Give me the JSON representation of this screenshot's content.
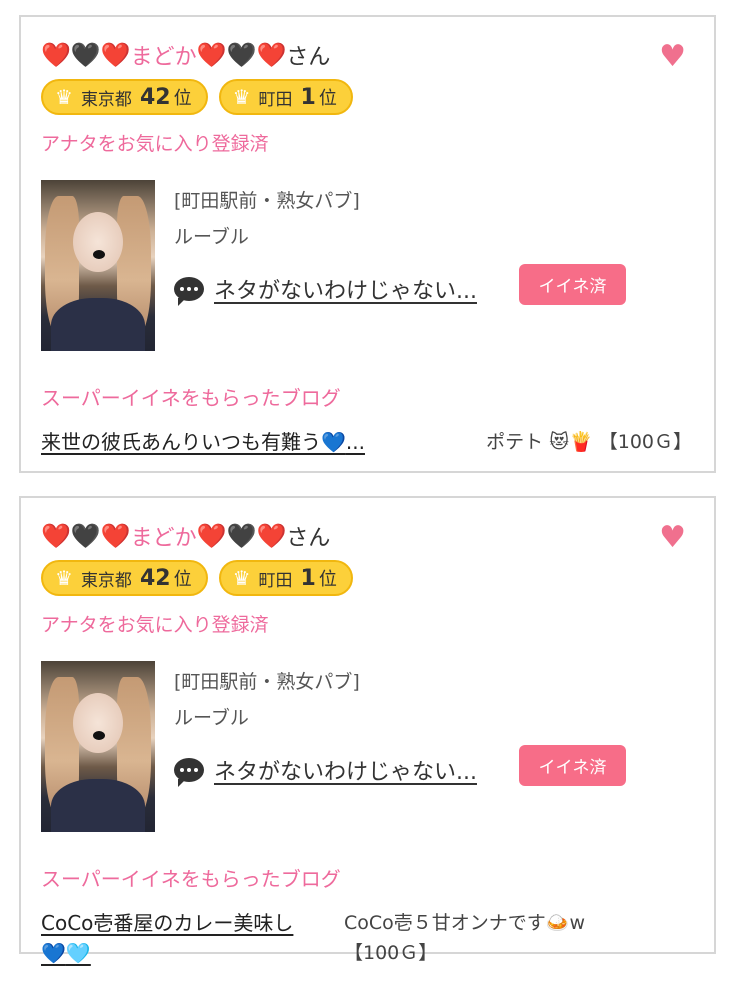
{
  "cards": [
    {
      "name": {
        "h1": "❤️",
        "h2": "🖤",
        "h3": "❤️",
        "text": "まどか",
        "h4": "❤️",
        "h5": "🖤",
        "h6": "❤️",
        "suffix": "さん"
      },
      "favorite_icon": "heart-icon",
      "badges": [
        {
          "icon": "crown-icon",
          "area": "東京都",
          "rank": "42",
          "unit": "位"
        },
        {
          "icon": "crown-icon",
          "area": "町田",
          "rank": "1",
          "unit": "位"
        }
      ],
      "fav_status": "アナタをお気に入り登録済",
      "shop_area": "[町田駅前・熟女パブ]",
      "shop_name": "ルーブル",
      "blog_title": "ネタがないわけじゃない...",
      "like_button": "イイネ済",
      "super_like_label": "スーパーイイネをもらったブログ",
      "super_blog": {
        "title": "来世の彼氏あんりいつも有難う",
        "emoji": "💙",
        "ellipsis": "..."
      },
      "gift": {
        "text": "ポテト",
        "emoji1": "😻",
        "emoji2": "🍟",
        "price": "【100Ｇ】"
      }
    },
    {
      "name": {
        "h1": "❤️",
        "h2": "🖤",
        "h3": "❤️",
        "text": "まどか",
        "h4": "❤️",
        "h5": "🖤",
        "h6": "❤️",
        "suffix": "さん"
      },
      "favorite_icon": "heart-icon",
      "badges": [
        {
          "icon": "crown-icon",
          "area": "東京都",
          "rank": "42",
          "unit": "位"
        },
        {
          "icon": "crown-icon",
          "area": "町田",
          "rank": "1",
          "unit": "位"
        }
      ],
      "fav_status": "アナタをお気に入り登録済",
      "shop_area": "[町田駅前・熟女パブ]",
      "shop_name": "ルーブル",
      "blog_title": "ネタがないわけじゃない...",
      "like_button": "イイネ済",
      "super_like_label": "スーパーイイネをもらったブログ",
      "super_blog": {
        "title": "CoCo壱番屋のカレー美味し",
        "emoji1": "💙",
        "emoji2": "🩵"
      },
      "gift": {
        "text": "CoCo壱５甘オンナです",
        "emoji": "🍛",
        "suffix": "w",
        "price": "【100Ｇ】"
      }
    }
  ]
}
